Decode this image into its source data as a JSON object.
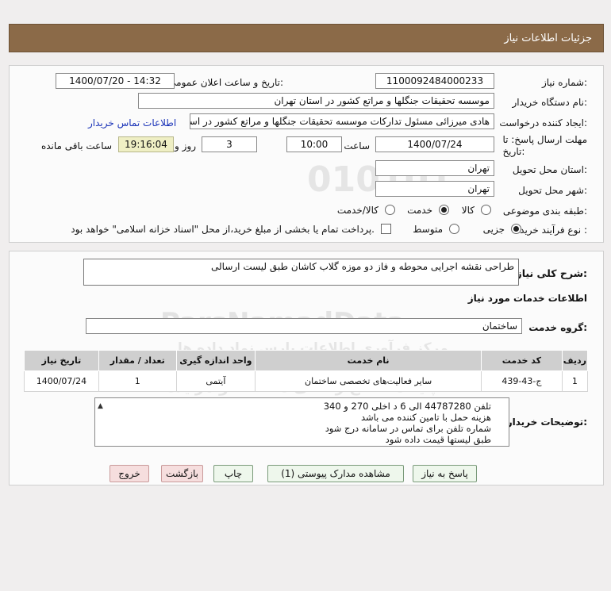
{
  "header": {
    "title": "جزئیات اطلاعات نیاز"
  },
  "form": {
    "need_number_label": "شماره نیاز:",
    "need_number": "1100092484000233",
    "announce_label": "تاریخ و ساعت اعلان عمومی:",
    "announce_value": "1400/07/20 - 14:32",
    "buyer_org_label": "نام دستگاه خریدار:",
    "buyer_org": "موسسه تحقیقات جنگلها و مراتع کشور در استان تهران",
    "creator_label": "ایجاد کننده درخواست:",
    "creator": "هادی میرزائی مسئول تدارکات موسسه تحقیقات جنگلها و مراتع کشور در استان",
    "contact_link": "اطلاعات تماس خریدار",
    "deadline_label_line1": "مهلت ارسال پاسخ: تا",
    "deadline_label_line2": "تاریخ:",
    "deadline_date": "1400/07/24",
    "time_label": "ساعت",
    "deadline_time": "10:00",
    "days_value": "3",
    "days_label": "روز و",
    "remaining_time": "19:16:04",
    "remaining_label": "ساعت باقی مانده",
    "province_label": "استان محل تحویل:",
    "province": "تهران",
    "city_label": "شهر محل تحویل:",
    "city": "تهران",
    "category_label": "طبقه بندی موضوعی:",
    "category_options": [
      "کالا",
      "خدمت",
      "کالا/خدمت"
    ],
    "category_selected": "خدمت",
    "process_label": "نوع فرآیند خرید :",
    "process_options": [
      "جزیی",
      "متوسط"
    ],
    "process_selected": "جزیی",
    "payment_note": "پرداخت تمام یا بخشی از مبلغ خرید،از محل \"اسناد خزانه اسلامی\" خواهد بود."
  },
  "details": {
    "summary_label": "شرح کلی نیاز:",
    "summary": "طراحی نقشه اجرایی محوطه و فاز دو موزه گلاب کاشان طبق لیست ارسالی",
    "services_title": "اطلاعات خدمات مورد نیاز",
    "service_group_label": "گروه خدمت:",
    "service_group": "ساختمان",
    "table_headers": [
      "ردیف",
      "کد خدمت",
      "نام خدمت",
      "واحد اندازه گیری",
      "تعداد / مقدار",
      "تاریخ نیاز"
    ],
    "table_rows": [
      [
        "1",
        "ج-43-439",
        "سایر فعالیت‌های تخصصی ساختمان",
        "آیتمی",
        "1",
        "1400/07/24"
      ]
    ],
    "buyer_notes_label": "توضیحات خریدار:",
    "buyer_notes": [
      "تلفن 44787280 الی 6 د اخلی 270 و 340",
      "هزینه حمل با تامین کننده می باشد",
      "شماره تلفن برای تماس در سامانه درج شود",
      "طبق لیستها قیمت داده شود"
    ]
  },
  "watermark": {
    "line1": "010101",
    "line2": "ParsNamadData",
    "line3": "مرکز فرآوری اطلاعات پارس نماد داده ها",
    "line4": "پایگاه اطلاع رسانی مناقصه و مزایده",
    "phone": "۰۲۱-۸۸۳۴۹۶۷۰"
  },
  "buttons": {
    "reply": "پاسخ به نیاز",
    "view_docs": "مشاهده مدارک پیوستی (1)",
    "print": "چاپ",
    "back": "بازگشت",
    "exit": "خروج"
  }
}
